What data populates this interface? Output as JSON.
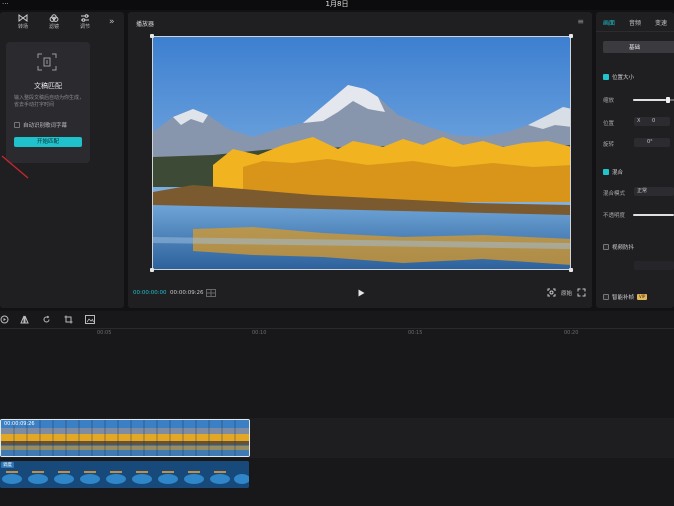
{
  "window": {
    "title": "1月8日",
    "menu_icon": "menu-dots-icon"
  },
  "left_panel": {
    "tabs": [
      {
        "label": "转场",
        "icon": "transition-icon"
      },
      {
        "label": "滤镜",
        "icon": "filter-icon"
      },
      {
        "label": "调节",
        "icon": "adjust-icon"
      }
    ],
    "expand_label": "»",
    "card": {
      "title": "文稿匹配",
      "description": "输入整段文稿后自动为你生成，省去手动打字时间",
      "checkbox_label": "自动识别歌词字幕",
      "button_label": "开始匹配"
    }
  },
  "player": {
    "title": "播放器",
    "current_time": "00:00:00:00",
    "total_time": "00:00:09:26",
    "ratio_label": "原始"
  },
  "right_panel": {
    "tabs": [
      "画面",
      "音频",
      "变速"
    ],
    "sub_tab": "基础",
    "position_size_label": "位置大小",
    "scale_label": "缩放",
    "position_label": "位置",
    "position_x": "X",
    "position_y_value": "0",
    "rotate_label": "旋转",
    "rotate_value": "0°",
    "blend_label": "混合",
    "blend_mode_label": "混合模式",
    "blend_mode_value": "正常",
    "opacity_label": "不透明度",
    "stabilize_label": "视频防抖",
    "smart_label": "智能补帧",
    "vip_badge": "VIP"
  },
  "timeline": {
    "ticks": [
      "00:05",
      "00:10",
      "00:15",
      "00:20"
    ],
    "main_clip_duration": "00:00:09:26",
    "audio_clip_label": "调度"
  },
  "colors": {
    "accent": "#1ec1cc",
    "panel": "#1f1f22",
    "background": "#121214"
  }
}
